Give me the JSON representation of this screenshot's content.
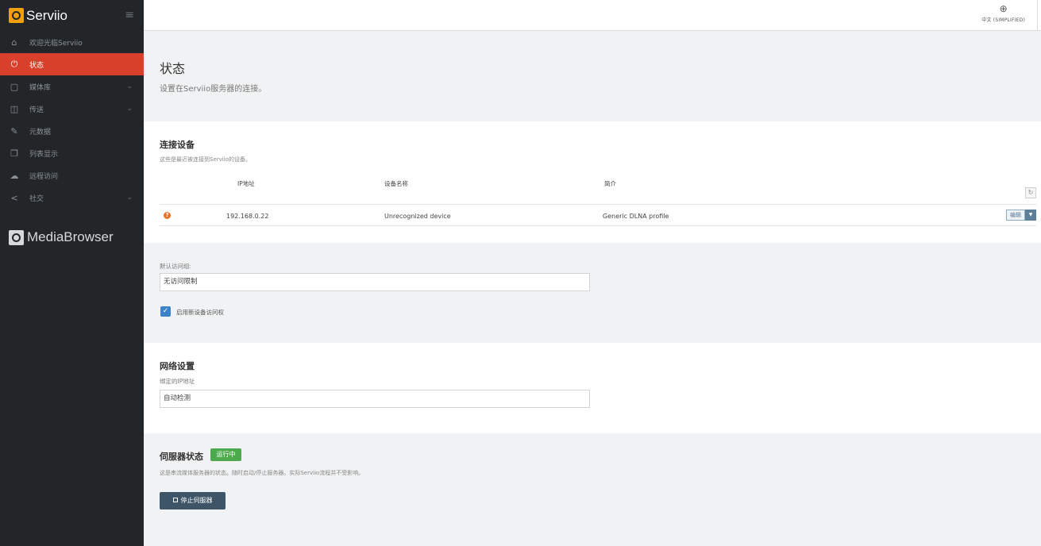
{
  "sidebar": {
    "brand": "Serviio",
    "items": [
      {
        "label": "欢迎光临Serviio",
        "icon": "home-icon"
      },
      {
        "label": "状态",
        "icon": "plug-icon"
      },
      {
        "label": "媒体库",
        "icon": "library-icon"
      },
      {
        "label": "传送",
        "icon": "box-icon"
      },
      {
        "label": "元数据",
        "icon": "edit-icon"
      },
      {
        "label": "列表显示",
        "icon": "list-icon"
      },
      {
        "label": "远程访问",
        "icon": "cloud-icon"
      },
      {
        "label": "社交",
        "icon": "share-icon"
      }
    ],
    "media_browser": "MediaBrowser"
  },
  "topbar": {
    "language": "中文 (SIMPLIFIED)"
  },
  "page": {
    "title": "状态",
    "subtitle": "设置在Serviio服务器的连接。"
  },
  "devices": {
    "title": "连接设备",
    "description": "这些是最近被连接到Serviio的设备。",
    "columns": [
      "IP地址",
      "设备名称",
      "简介"
    ],
    "rows": [
      {
        "ip": "192.168.0.22",
        "name": "Unrecognized device",
        "profile": "Generic DLNA profile"
      }
    ],
    "edit_label": "编辑"
  },
  "access": {
    "label": "默认访问组:",
    "value": "无访问限制",
    "checkbox_label": "启用新设备访问权",
    "checked": true
  },
  "network": {
    "title": "网络设置",
    "bind_label": "绑定的IP地址",
    "bind_value": "自动检测"
  },
  "server": {
    "title": "伺服器状态",
    "status": "运行中",
    "description": "这是串流媒体服务器的状态。随时启动/停止服务器。实际Serviio流程并不受影响。",
    "stop_label": "停止伺服器"
  },
  "colors": {
    "sidebar_bg": "#222629",
    "active_item": "#d9402b",
    "brand_accent": "#f0a10a",
    "status_green": "#4caa4c",
    "primary_button": "#3d5566",
    "checkbox_blue": "#3b82c8"
  }
}
